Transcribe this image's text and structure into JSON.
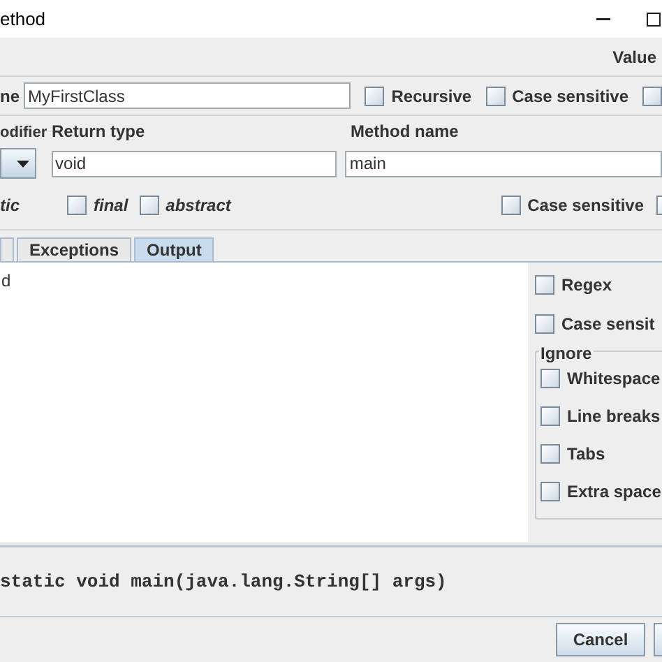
{
  "window": {
    "title": "ethod"
  },
  "header": {
    "label": "Value"
  },
  "class_row": {
    "label": "ne",
    "value": "MyFirstClass",
    "options": [
      {
        "label": "Recursive",
        "checked": false
      },
      {
        "label": "Case sensitive",
        "checked": false
      },
      {
        "checked": false
      }
    ]
  },
  "method_row": {
    "labels": [
      "odifier",
      "Return type",
      "Method name"
    ],
    "return_type": "void",
    "method_name": "main"
  },
  "modifiers": {
    "static_label": "tic",
    "options": [
      {
        "label": "final",
        "checked": false
      },
      {
        "label": "abstract",
        "checked": false
      }
    ],
    "right_options": [
      {
        "label": "Case sensitive",
        "checked": false
      },
      {
        "checked": false
      }
    ]
  },
  "tabs": [
    {
      "label": "Exceptions",
      "selected": false
    },
    {
      "label": "Output",
      "selected": true
    }
  ],
  "output": {
    "text": "d"
  },
  "match_options": [
    {
      "label": "Regex",
      "checked": false
    },
    {
      "label": "Case sensit",
      "checked": false
    }
  ],
  "ignore": {
    "title": "Ignore",
    "options": [
      {
        "label": "Whitespace",
        "checked": false
      },
      {
        "label": "Line breaks",
        "checked": false
      },
      {
        "label": "Tabs",
        "checked": false
      },
      {
        "label": "Extra space",
        "checked": false
      }
    ]
  },
  "signature": "static void main(java.lang.String[] args)",
  "buttons": [
    {
      "label": "Cancel"
    }
  ]
}
